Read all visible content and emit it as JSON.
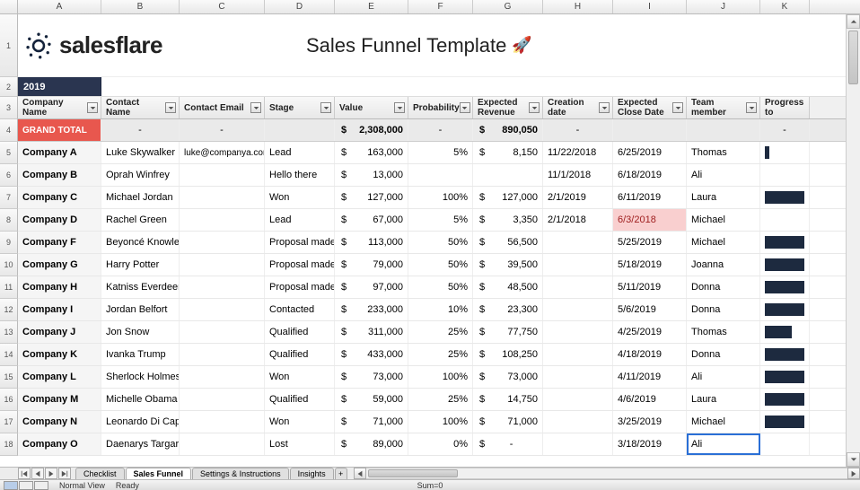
{
  "col_letters": [
    "A",
    "B",
    "C",
    "D",
    "E",
    "F",
    "G",
    "H",
    "I",
    "J",
    "K"
  ],
  "title": {
    "brand": "salesflare",
    "doc_title": "Sales Funnel Template"
  },
  "year_label": "2019",
  "headers": {
    "company": "Company Name",
    "contact": "Contact Name",
    "email": "Contact Email",
    "stage": "Stage",
    "value": "Value",
    "probability": "Probability",
    "expected_rev": "Expected Revenue",
    "creation": "Creation date",
    "close": "Expected Close Date",
    "team": "Team member",
    "progress": "Progress to"
  },
  "grand_total": {
    "label": "GRAND TOTAL",
    "value": "2,308,000",
    "expected_rev": "890,050",
    "dash": "-",
    "currency": "$"
  },
  "rows": [
    {
      "company": "Company A",
      "contact": "Luke Skywalker",
      "email": "luke@companya.com",
      "stage": "Lead",
      "value": "163,000",
      "prob": "5%",
      "exp_rev": "8,150",
      "created": "11/22/2018",
      "close": "6/25/2019",
      "close_warn": false,
      "team": "Thomas",
      "bar": 5
    },
    {
      "company": "Company B",
      "contact": "Oprah Winfrey",
      "email": "",
      "stage": "Hello there",
      "value": "13,000",
      "prob": "",
      "exp_rev": "",
      "created": "11/1/2018",
      "close": "6/18/2019",
      "close_warn": false,
      "team": "Ali",
      "bar": 0
    },
    {
      "company": "Company C",
      "contact": "Michael Jordan",
      "email": "",
      "stage": "Won",
      "value": "127,000",
      "prob": "100%",
      "exp_rev": "127,000",
      "created": "2/1/2019",
      "close": "6/11/2019",
      "close_warn": false,
      "team": "Laura",
      "bar": 55
    },
    {
      "company": "Company D",
      "contact": "Rachel Green",
      "email": "",
      "stage": "Lead",
      "value": "67,000",
      "prob": "5%",
      "exp_rev": "3,350",
      "created": "2/1/2018",
      "close": "6/3/2018",
      "close_warn": true,
      "team": "Michael",
      "bar": 0
    },
    {
      "company": "Company F",
      "contact": "Beyoncé Knowles",
      "email": "",
      "stage": "Proposal made",
      "value": "113,000",
      "prob": "50%",
      "exp_rev": "56,500",
      "created": "",
      "close": "5/25/2019",
      "close_warn": false,
      "team": "Michael",
      "bar": 55
    },
    {
      "company": "Company G",
      "contact": "Harry Potter",
      "email": "",
      "stage": "Proposal made",
      "value": "79,000",
      "prob": "50%",
      "exp_rev": "39,500",
      "created": "",
      "close": "5/18/2019",
      "close_warn": false,
      "team": "Joanna",
      "bar": 55
    },
    {
      "company": "Company H",
      "contact": "Katniss Everdeen",
      "email": "",
      "stage": "Proposal made",
      "value": "97,000",
      "prob": "50%",
      "exp_rev": "48,500",
      "created": "",
      "close": "5/11/2019",
      "close_warn": false,
      "team": "Donna",
      "bar": 55
    },
    {
      "company": "Company I",
      "contact": "Jordan Belfort",
      "email": "",
      "stage": "Contacted",
      "value": "233,000",
      "prob": "10%",
      "exp_rev": "23,300",
      "created": "",
      "close": "5/6/2019",
      "close_warn": false,
      "team": "Donna",
      "bar": 55
    },
    {
      "company": "Company J",
      "contact": "Jon Snow",
      "email": "",
      "stage": "Qualified",
      "value": "311,000",
      "prob": "25%",
      "exp_rev": "77,750",
      "created": "",
      "close": "4/25/2019",
      "close_warn": false,
      "team": "Thomas",
      "bar": 30
    },
    {
      "company": "Company K",
      "contact": "Ivanka Trump",
      "email": "",
      "stage": "Qualified",
      "value": "433,000",
      "prob": "25%",
      "exp_rev": "108,250",
      "created": "",
      "close": "4/18/2019",
      "close_warn": false,
      "team": "Donna",
      "bar": 55
    },
    {
      "company": "Company L",
      "contact": "Sherlock Holmes",
      "email": "",
      "stage": "Won",
      "value": "73,000",
      "prob": "100%",
      "exp_rev": "73,000",
      "created": "",
      "close": "4/11/2019",
      "close_warn": false,
      "team": "Ali",
      "bar": 55
    },
    {
      "company": "Company M",
      "contact": "Michelle Obama",
      "email": "",
      "stage": "Qualified",
      "value": "59,000",
      "prob": "25%",
      "exp_rev": "14,750",
      "created": "",
      "close": "4/6/2019",
      "close_warn": false,
      "team": "Laura",
      "bar": 55
    },
    {
      "company": "Company N",
      "contact": "Leonardo Di Caprio",
      "email": "",
      "stage": "Won",
      "value": "71,000",
      "prob": "100%",
      "exp_rev": "71,000",
      "created": "",
      "close": "3/25/2019",
      "close_warn": false,
      "team": "Michael",
      "bar": 55
    },
    {
      "company": "Company O",
      "contact": "Daenarys Targaryen",
      "email": "",
      "stage": "Lost",
      "value": "89,000",
      "prob": "0%",
      "exp_rev": "-",
      "exp_rev_is_dash": true,
      "created": "",
      "close": "3/18/2019",
      "close_warn": false,
      "team": "Ali",
      "bar": 0,
      "selected": true
    }
  ],
  "tabs": [
    "Checklist",
    "Sales Funnel",
    "Settings & Instructions",
    "Insights"
  ],
  "active_tab": 1,
  "status": {
    "view": "Normal View",
    "ready": "Ready",
    "sum": "Sum=0"
  }
}
